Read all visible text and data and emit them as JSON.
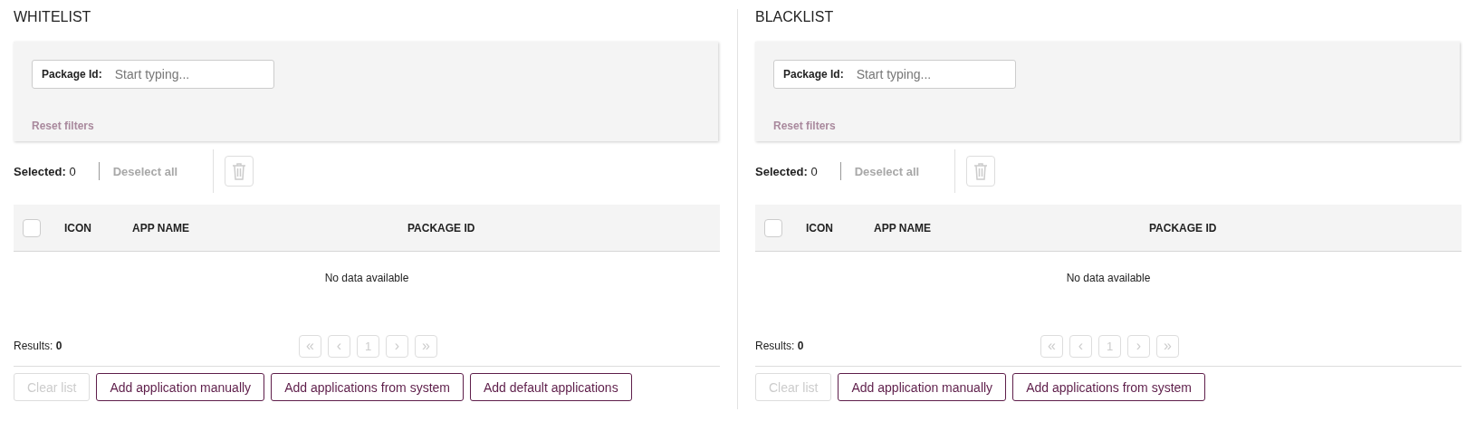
{
  "panels": [
    {
      "title": "WHITELIST",
      "filter": {
        "label": "Package Id:",
        "placeholder": "Start typing..."
      },
      "reset_filters": {
        "label": "Reset filters",
        "disabled": true
      },
      "selection": {
        "label": "Selected:",
        "count": "0",
        "deselect_all": "Deselect all",
        "disabled": true
      },
      "table": {
        "select_all": {
          "checked": false
        },
        "columns": [
          "ICON",
          "APP NAME",
          "PACKAGE ID"
        ],
        "empty_message": "No data available"
      },
      "results": {
        "label": "Results:",
        "count": "0"
      },
      "pagination": [
        {
          "label": "«",
          "kind": "nav",
          "disabled": true
        },
        {
          "label": "‹",
          "kind": "nav",
          "disabled": true
        },
        {
          "label": "1",
          "kind": "page",
          "disabled": true
        },
        {
          "label": "›",
          "kind": "nav",
          "disabled": true
        },
        {
          "label": "»",
          "kind": "nav",
          "disabled": true
        }
      ],
      "buttons": [
        {
          "label": "Clear list",
          "disabled": true
        },
        {
          "label": "Add application manually",
          "disabled": false
        },
        {
          "label": "Add applications from system",
          "disabled": false
        },
        {
          "label": "Add default applications",
          "disabled": false
        }
      ]
    },
    {
      "title": "BLACKLIST",
      "filter": {
        "label": "Package Id:",
        "placeholder": "Start typing..."
      },
      "reset_filters": {
        "label": "Reset filters",
        "disabled": true
      },
      "selection": {
        "label": "Selected:",
        "count": "0",
        "deselect_all": "Deselect all",
        "disabled": true
      },
      "table": {
        "select_all": {
          "checked": false
        },
        "columns": [
          "ICON",
          "APP NAME",
          "PACKAGE ID"
        ],
        "empty_message": "No data available"
      },
      "results": {
        "label": "Results:",
        "count": "0"
      },
      "pagination": [
        {
          "label": "«",
          "kind": "nav",
          "disabled": true
        },
        {
          "label": "‹",
          "kind": "nav",
          "disabled": true
        },
        {
          "label": "1",
          "kind": "page",
          "disabled": true
        },
        {
          "label": "›",
          "kind": "nav",
          "disabled": true
        },
        {
          "label": "»",
          "kind": "nav",
          "disabled": true
        }
      ],
      "buttons": [
        {
          "label": "Clear list",
          "disabled": true
        },
        {
          "label": "Add application manually",
          "disabled": false
        },
        {
          "label": "Add applications from system",
          "disabled": false
        }
      ]
    }
  ]
}
